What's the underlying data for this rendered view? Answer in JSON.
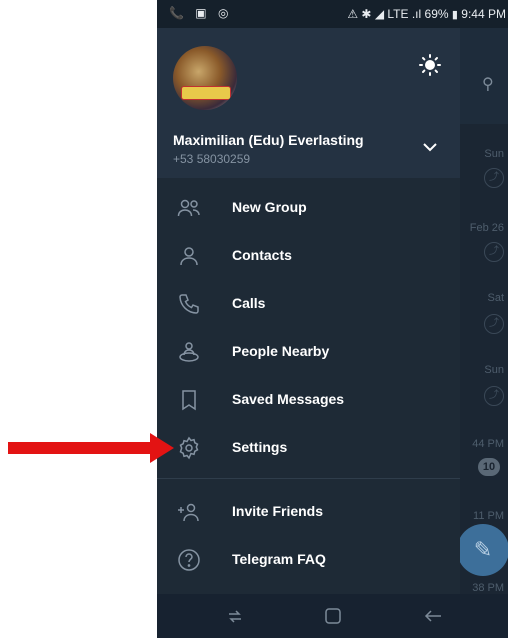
{
  "status_bar": {
    "left_icons": "📞 ▣ ◎",
    "indicators": "⚠ ✱ ◢ LTE .ıl",
    "battery": "69%",
    "time": "9:44 PM"
  },
  "profile": {
    "name": "Maximilian (Edu) Everlasting",
    "phone": "+53 58030259"
  },
  "menu": [
    {
      "label": "New Group",
      "icon": "new-group-icon"
    },
    {
      "label": "Contacts",
      "icon": "contacts-icon"
    },
    {
      "label": "Calls",
      "icon": "calls-icon"
    },
    {
      "label": "People Nearby",
      "icon": "people-nearby-icon"
    },
    {
      "label": "Saved Messages",
      "icon": "saved-messages-icon"
    },
    {
      "label": "Settings",
      "icon": "settings-icon"
    },
    {
      "label": "Invite Friends",
      "icon": "invite-friends-icon"
    },
    {
      "label": "Telegram FAQ",
      "icon": "faq-icon"
    }
  ],
  "background_chats": {
    "times": [
      "Sun",
      "Feb 26",
      "Sat",
      "Sun",
      "44 PM",
      "11 PM",
      "38 PM"
    ],
    "badge": "10"
  },
  "colors": {
    "drawer": "#1e2a36",
    "header": "#243242",
    "accent_arrow": "#e31313"
  }
}
